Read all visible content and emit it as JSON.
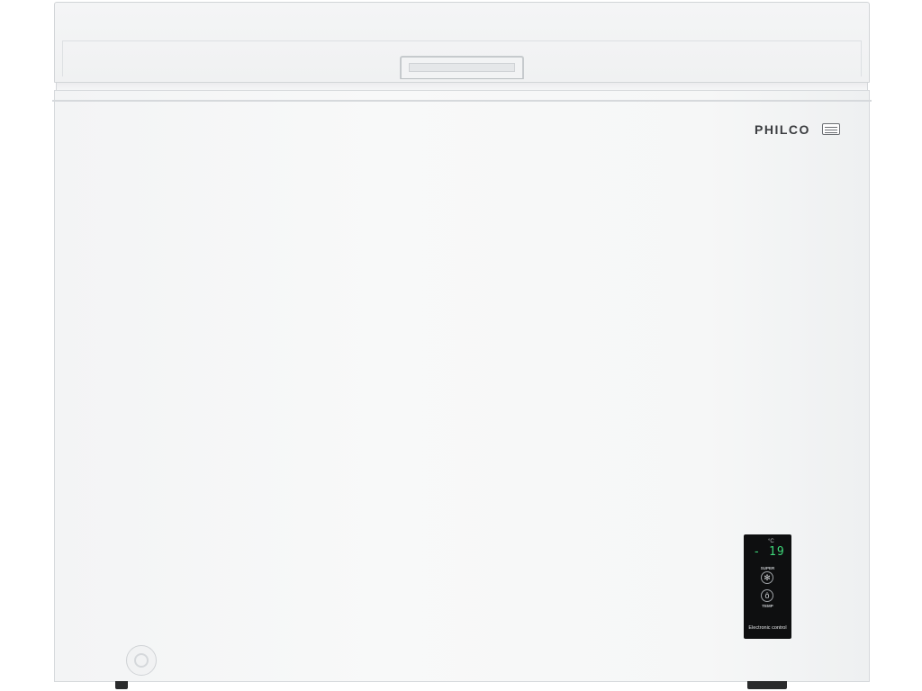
{
  "product": {
    "brand": "PHILCO",
    "control_panel": {
      "unit": "°C",
      "temperature": "- 19",
      "super_label": "SUPER",
      "super_icon": "snowflake-icon",
      "temp_label": "TEMP",
      "temp_icon": "thermometer-icon",
      "caption": "Electronic control"
    }
  },
  "colors": {
    "body": "#f6f7f7",
    "panel": "#0e0f10",
    "display_digits": "#3ed97a"
  }
}
